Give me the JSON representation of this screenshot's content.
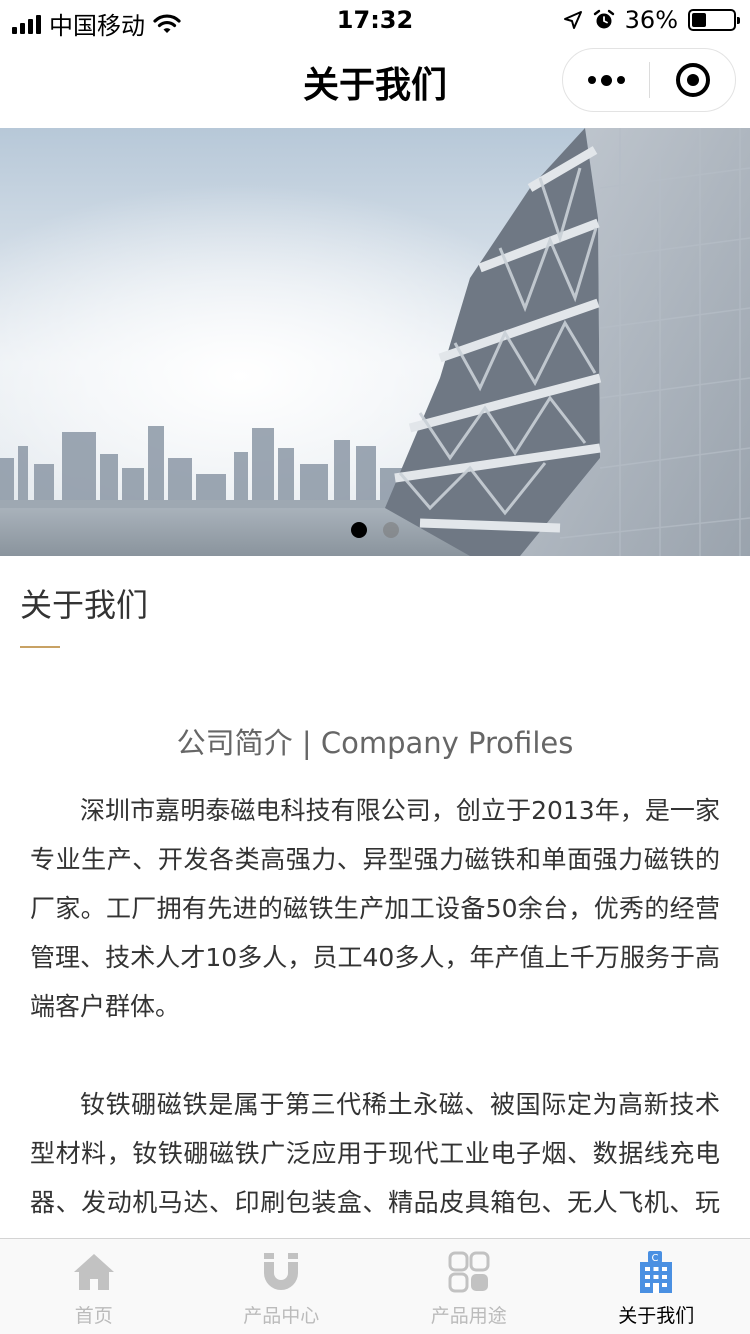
{
  "status_bar": {
    "carrier": "中国移动",
    "time": "17:32",
    "battery": "36%",
    "battery_level": 0.36
  },
  "nav": {
    "title": "关于我们"
  },
  "banner": {
    "slide_count": 2,
    "active_slide": 1
  },
  "section": {
    "title": "关于我们",
    "accent_color": "#c8a264"
  },
  "content": {
    "subtitle": "公司简介 | Company Profiles",
    "paragraphs": [
      "深圳市嘉明泰磁电科技有限公司，创立于2013年，是一家专业生产、开发各类高强力、异型强力磁铁和单面强力磁铁的厂家。工厂拥有先进的磁铁生产加工设备50余台，优秀的经营管理、技术人才10多人，员工40多人，年产值上千万服务于高端客户群体。",
      "钕铁硼磁铁是属于第三代稀土永磁、被国际定为高新技术型材料，钕铁硼磁铁广泛应用于现代工业电子烟、数据线充电器、发动机马达、印刷包装盒、精品皮具箱包、无人飞机、玩具、新能源汽车、风能发电、军"
    ]
  },
  "tab_bar": {
    "tabs": [
      {
        "label": "首页",
        "icon": "home-icon",
        "active": false
      },
      {
        "label": "产品中心",
        "icon": "magnet-icon",
        "active": false
      },
      {
        "label": "产品用途",
        "icon": "grid-icon",
        "active": false
      },
      {
        "label": "关于我们",
        "icon": "building-icon",
        "active": true
      }
    ],
    "active_color": "#000000",
    "inactive_color": "#bbbbbb"
  }
}
